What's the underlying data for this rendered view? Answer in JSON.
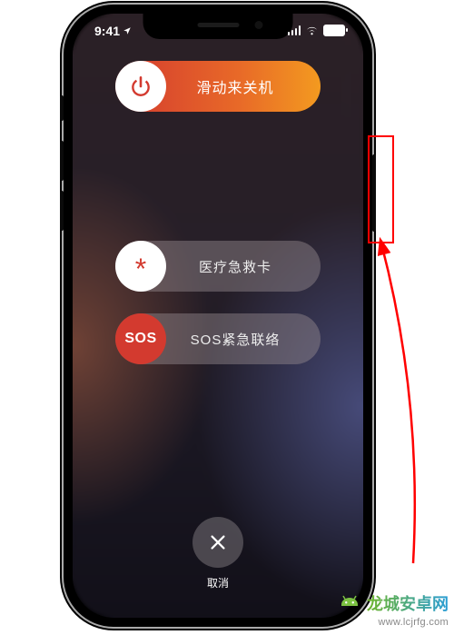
{
  "status_bar": {
    "time": "9:41"
  },
  "sliders": {
    "power": {
      "label": "滑动来关机",
      "icon": "power-icon"
    },
    "medical": {
      "label": "医疗急救卡",
      "icon": "asterisk-icon",
      "glyph": "*"
    },
    "sos": {
      "label": "SOS紧急联络",
      "icon": "sos-icon",
      "badge": "SOS"
    }
  },
  "cancel": {
    "label": "取消"
  },
  "watermark": {
    "brand": "龙城安卓网",
    "url": "www.lcjrfg.com"
  }
}
